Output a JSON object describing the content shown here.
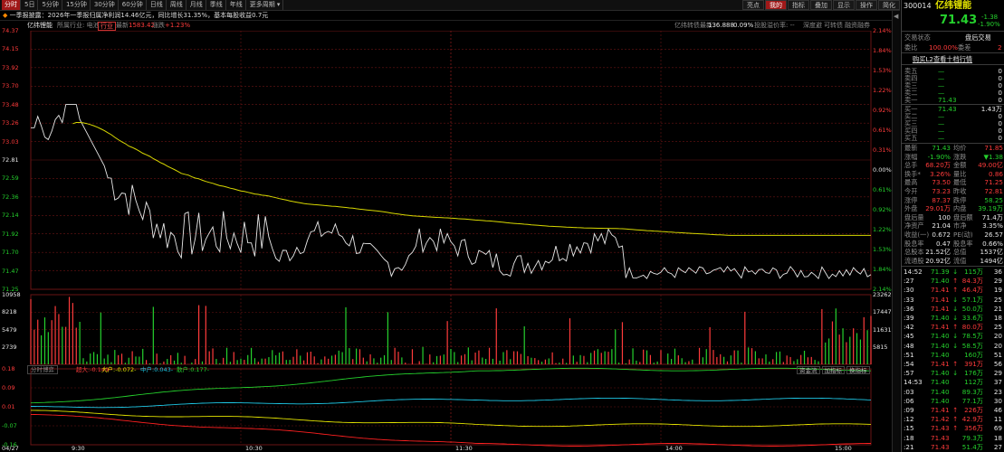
{
  "tabs": [
    "分时",
    "5日",
    "5分钟",
    "15分钟",
    "30分钟",
    "60分钟",
    "日线",
    "周线",
    "月线",
    "季线",
    "年线",
    "更多周期 ▾"
  ],
  "toolbar_right": [
    "亮点",
    "我的",
    "指标",
    "叠加",
    "显示",
    "操作",
    "简化"
  ],
  "news": "一季报披露：2026年一季报归属净利润14.46亿元，同比增长31.35%，基本每股收益0.7元",
  "info": {
    "name": "亿纬锂能",
    "industry_label": "所属行业: 电池",
    "industry_tag": "行业",
    "latest_label": "最新",
    "latest": "1583.42",
    "change_label": "涨跌",
    "change": "+1.23%",
    "turnover_label": "亿纬转债最新",
    "turnover": "136.888",
    "pct": "0.09%",
    "vs_label": "投股溢价率: --",
    "b1": "深度避",
    "b2": "可转债",
    "b3": "融资融券"
  },
  "price_axis": {
    "left": [
      "74.37",
      "74.15",
      "73.92",
      "73.70",
      "73.48",
      "73.26",
      "73.03",
      "72.81",
      "72.59",
      "72.36",
      "72.14",
      "71.92",
      "71.70",
      "71.47",
      "71.25"
    ],
    "right": [
      "2.14%",
      "1.84%",
      "1.53%",
      "1.22%",
      "0.92%",
      "0.61%",
      "0.31%",
      "0.00%",
      "0.61%",
      "0.92%",
      "1.22%",
      "1.53%",
      "1.84%",
      "2.14%"
    ]
  },
  "vol_axis": {
    "left": [
      "10958",
      "8218",
      "5479",
      "2739"
    ],
    "right": [
      "23262",
      "17447",
      "11631",
      "5815"
    ]
  },
  "ind_axis": {
    "left": [
      "0.18",
      "0.09",
      "0.01",
      "-0.07",
      "-0.16"
    ]
  },
  "ind_legend": {
    "title": "分时博弈",
    "super": "超大:-0.149-",
    "big": "大户:-0.072-",
    "mid": "中户:0.043-",
    "small": "散户:0.177-",
    "btns": [
      "资金流",
      "加指标",
      "换指标"
    ]
  },
  "time_axis": [
    "04/27",
    "9:30",
    "10:30",
    "11:30",
    "14:00",
    "15:00"
  ],
  "quote": {
    "code": "300014",
    "name": "亿纬锂能",
    "price": "71.43",
    "chg": "-1.38",
    "pct": "-1.90%"
  },
  "side_tabs": [
    "交易状态",
    "盘后交易"
  ],
  "ratio": {
    "wb_label": "委比",
    "wb": "100.00%",
    "wc_label": "委差",
    "wc": "2"
  },
  "l2": "购买L2查看十档行情",
  "asks": [
    [
      "卖五",
      "—",
      "0"
    ],
    [
      "卖四",
      "—",
      "0"
    ],
    [
      "卖三",
      "—",
      "0"
    ],
    [
      "卖二",
      "—",
      "0"
    ],
    [
      "卖一",
      "71.43",
      "0"
    ]
  ],
  "bids": [
    [
      "买一",
      "71.43",
      "1.43万"
    ],
    [
      "买二",
      "—",
      "0"
    ],
    [
      "买三",
      "—",
      "0"
    ],
    [
      "买四",
      "—",
      "0"
    ],
    [
      "买五",
      "—",
      "0"
    ]
  ],
  "stats": [
    [
      "最新",
      "71.43",
      "均价",
      "71.85"
    ],
    [
      "涨幅",
      "-1.90%",
      "涨跌",
      "▼1.38"
    ],
    [
      "总手",
      "68.20万",
      "金额",
      "49.00亿"
    ],
    [
      "换手*",
      "3.26%",
      "量比",
      "0.86"
    ],
    [
      "最高",
      "73.50",
      "最低",
      "71.25"
    ],
    [
      "今开",
      "73.23",
      "昨收",
      "72.81"
    ],
    [
      "涨停",
      "87.37",
      "跌停",
      "58.25"
    ],
    [
      "外盘",
      "29.01万",
      "内盘",
      "39.19万"
    ],
    [
      "盘后量",
      "100",
      "盘后额",
      "71.4万"
    ],
    [
      "净资产",
      "21.04",
      "市净",
      "3.35%"
    ],
    [
      "收益(一)",
      "0.672",
      "PE(动)",
      "26.57"
    ],
    [
      "股息率",
      "0.47",
      "股息率",
      "0.66%"
    ],
    [
      "总股本",
      "21.52亿",
      "总值",
      "1537亿"
    ],
    [
      "流通股",
      "20.92亿",
      "流值",
      "1494亿"
    ]
  ],
  "ticks": [
    [
      "14:52",
      "71.39",
      "↓",
      "115万",
      "36"
    ],
    [
      ":27",
      "71.40",
      "↑",
      "84.3万",
      "29"
    ],
    [
      ":30",
      "71.41",
      "↑",
      "46.4万",
      "19"
    ],
    [
      ":33",
      "71.41",
      "↓",
      "57.1万",
      "25"
    ],
    [
      ":36",
      "71.41",
      "↓",
      "50.0万",
      "21"
    ],
    [
      ":39",
      "71.40",
      "↓",
      "33.6万",
      "18"
    ],
    [
      ":42",
      "71.41",
      "↑",
      "80.0万",
      "25"
    ],
    [
      ":45",
      "71.40",
      "↓",
      "78.5万",
      "20"
    ],
    [
      ":48",
      "71.40",
      "↓",
      "58.5万",
      "20"
    ],
    [
      ":51",
      "71.40",
      "",
      "160万",
      "51"
    ],
    [
      ":54",
      "71.41",
      "↑",
      "391万",
      "56"
    ],
    [
      ":57",
      "71.40",
      "↓",
      "176万",
      "29"
    ],
    [
      "14:53",
      "71.40",
      "",
      "112万",
      "37"
    ],
    [
      ":03",
      "71.40",
      "",
      "89.3万",
      "23"
    ],
    [
      ":06",
      "71.40",
      "",
      "77.1万",
      "30"
    ],
    [
      ":09",
      "71.41",
      "↑",
      "226万",
      "46"
    ],
    [
      ":12",
      "71.42",
      "↑",
      "42.9万",
      "11"
    ],
    [
      ":15",
      "71.43",
      "↑",
      "356万",
      "69"
    ],
    [
      ":18",
      "71.43",
      "",
      "79.3万",
      "18"
    ],
    [
      ":21",
      "71.43",
      "",
      "51.4万",
      "27"
    ]
  ],
  "colors": {
    "up": "#ff3b3b",
    "down": "#25d12d",
    "price": "#e8e8e8",
    "avg": "#d8d800",
    "grid": "#6a1515"
  }
}
